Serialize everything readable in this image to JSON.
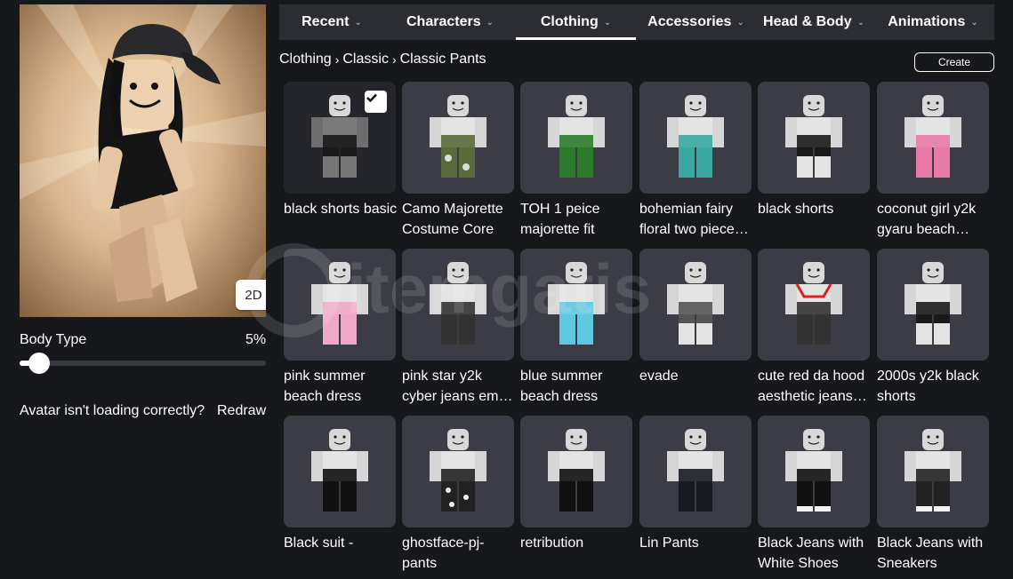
{
  "avatar": {
    "view_button_label": "2D",
    "body_type_label": "Body Type",
    "body_type_value_text": "5%",
    "body_type_fraction": 0.05,
    "loading_text": "Avatar isn't loading correctly?",
    "redraw_label": "Redraw"
  },
  "tabs": [
    {
      "label": "Recent",
      "active": false
    },
    {
      "label": "Characters",
      "active": false
    },
    {
      "label": "Clothing",
      "active": true
    },
    {
      "label": "Accessories",
      "active": false
    },
    {
      "label": "Head & Body",
      "active": false
    },
    {
      "label": "Animations",
      "active": false
    }
  ],
  "breadcrumb": [
    "Clothing",
    "Classic",
    "Classic Pants"
  ],
  "create_label": "Create",
  "watermark_text": "itemgatis",
  "items": [
    {
      "name": "black shorts basic",
      "selected": true,
      "pants": "#1a1a1a",
      "style": "shorts"
    },
    {
      "name": "Camo Majorette Costume Core",
      "selected": false,
      "pants": "#5a6a3a",
      "style": "camo"
    },
    {
      "name": "TOH 1 peice majorette fit",
      "selected": false,
      "pants": "#2b7a2b",
      "style": "green"
    },
    {
      "name": "bohemian fairy floral two piece…",
      "selected": false,
      "pants": "#3aa8a0",
      "style": "teal"
    },
    {
      "name": "black shorts",
      "selected": false,
      "pants": "#1a1a1a",
      "style": "shorts"
    },
    {
      "name": "coconut girl y2k gyaru beach…",
      "selected": false,
      "pants": "#e77aa6",
      "style": "pink"
    },
    {
      "name": "pink summer beach dress",
      "selected": false,
      "pants": "#f0a8c8",
      "style": "pinkdress"
    },
    {
      "name": "pink star y2k cyber jeans em…",
      "selected": false,
      "pants": "#333333",
      "style": "jeans"
    },
    {
      "name": "blue summer beach dress",
      "selected": false,
      "pants": "#5ec8e0",
      "style": "bluedress"
    },
    {
      "name": "evade",
      "selected": false,
      "pants": "#555555",
      "style": "grey"
    },
    {
      "name": "cute red da hood aesthetic jeans…",
      "selected": false,
      "pants": "#333333",
      "style": "redhood"
    },
    {
      "name": "2000s y2k black shorts",
      "selected": false,
      "pants": "#1a1a1a",
      "style": "shorts"
    },
    {
      "name": "Black suit -",
      "selected": false,
      "pants": "#111111",
      "style": "black"
    },
    {
      "name": "ghostface-pj-pants",
      "selected": false,
      "pants": "#222222",
      "style": "ghost"
    },
    {
      "name": "retribution",
      "selected": false,
      "pants": "#111111",
      "style": "black"
    },
    {
      "name": "Lin Pants",
      "selected": false,
      "pants": "#1a1a22",
      "style": "lin"
    },
    {
      "name": "Black Jeans with White Shoes",
      "selected": false,
      "pants": "#111111",
      "style": "blackjeans"
    },
    {
      "name": "Black Jeans with Sneakers",
      "selected": false,
      "pants": "#222222",
      "style": "sneakers"
    }
  ]
}
